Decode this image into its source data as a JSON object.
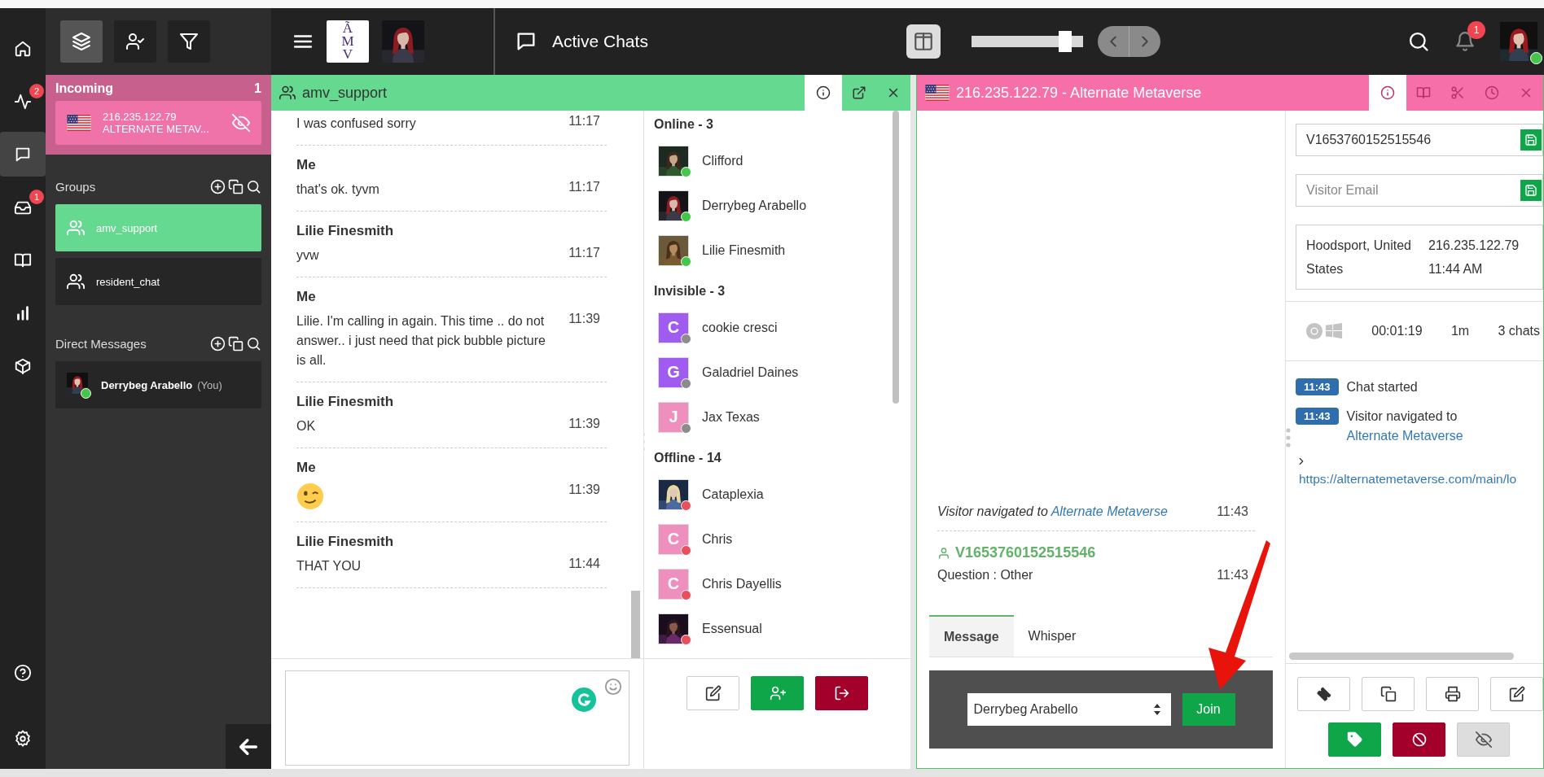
{
  "rail": {
    "items": [
      {
        "kind": "home",
        "selected": false
      },
      {
        "kind": "activity",
        "badge": "2",
        "selected": false
      },
      {
        "kind": "chat",
        "selected": true
      },
      {
        "kind": "inbox",
        "badge": "1",
        "selected": false
      },
      {
        "kind": "book",
        "selected": false
      },
      {
        "kind": "chart",
        "selected": false
      },
      {
        "kind": "cube",
        "selected": false
      }
    ],
    "bottom": [
      {
        "kind": "help",
        "selected": false
      },
      {
        "kind": "settings",
        "selected": false
      }
    ]
  },
  "sidebar": {
    "tools": [
      {
        "kind": "layers",
        "selected": true
      },
      {
        "kind": "user-check",
        "selected": false
      },
      {
        "kind": "filter",
        "selected": false
      }
    ],
    "incoming": {
      "title": "Incoming",
      "count": "1",
      "visitors": [
        {
          "ip": "216.235.122.79",
          "site": "ALTERNATE METAV..."
        }
      ]
    },
    "groups": {
      "title": "Groups",
      "items": [
        {
          "name": "amv_support",
          "selected": true
        },
        {
          "name": "resident_chat",
          "selected": false
        }
      ]
    },
    "direct_messages": {
      "title": "Direct Messages",
      "items": [
        {
          "name": "Derrybeg Arabello",
          "suffix": "(You)",
          "color": "#44c64a"
        }
      ]
    }
  },
  "topbar": {
    "logo": "ÃMV",
    "title": "Active Chats",
    "zoom": {
      "level": 0.9
    },
    "notifications": "1"
  },
  "group_chat": {
    "title": "amv_support",
    "tabs": [
      {
        "kind": "info",
        "selected": true
      },
      {
        "kind": "popout",
        "selected": false
      },
      {
        "kind": "close",
        "selected": false
      }
    ],
    "messages": [
      {
        "kind": "text",
        "text": "I was confused sorry",
        "time": "11:17"
      },
      {
        "kind": "text",
        "sender": "Me",
        "text": "that's ok. tyvm",
        "time": "11:17"
      },
      {
        "kind": "text",
        "sender": "Lilie Finesmith",
        "text": "yvw",
        "time": "11:17"
      },
      {
        "kind": "text",
        "sender": "Me",
        "text": "Lilie. I'm calling in again. This time .. do not answer.. i just need that pick bubble picture is all.",
        "time": "11:39"
      },
      {
        "kind": "text",
        "sender": "Lilie Finesmith",
        "text": "OK",
        "time": "11:39"
      },
      {
        "kind": "emoji",
        "sender": "Me",
        "time": "11:39"
      },
      {
        "kind": "text",
        "sender": "Lilie Finesmith",
        "text": "THAT YOU",
        "time": "11:44"
      }
    ],
    "members": [
      {
        "title": "Online - 3",
        "users": [
          {
            "name": "Clifford",
            "color": "#44c64a"
          },
          {
            "name": "Derrybeg Arabello",
            "color": "#44c64a"
          },
          {
            "name": "Lilie Finesmith",
            "color": "#44c64a"
          }
        ]
      },
      {
        "title": "Invisible - 3",
        "users": [
          {
            "name": "cookie cresci",
            "avatar": {
              "kind": "letter",
              "initial": "C",
              "color": "#a05cf0"
            },
            "color": "#8c8c8c"
          },
          {
            "name": "Galadriel Daines",
            "avatar": {
              "kind": "letter",
              "initial": "G",
              "color": "#a05cf0"
            },
            "color": "#8c8c8c"
          },
          {
            "name": "Jax Texas",
            "avatar": {
              "kind": "letter",
              "initial": "J",
              "color": "#ef8fbd"
            },
            "color": "#8c8c8c"
          }
        ]
      },
      {
        "title": "Offline - 14",
        "users": [
          {
            "name": "Cataplexia",
            "color": "#e8505b"
          },
          {
            "name": "Chris",
            "avatar": {
              "kind": "letter",
              "initial": "C",
              "color": "#ef8fbd"
            },
            "color": "#e8505b"
          },
          {
            "name": "Chris Dayellis",
            "avatar": {
              "kind": "letter",
              "initial": "C",
              "color": "#ef8fbd"
            },
            "color": "#e8505b"
          },
          {
            "name": "Essensual",
            "color": "#e8505b"
          }
        ]
      }
    ],
    "actions": [
      {
        "kind": "edit"
      },
      {
        "kind": "user-plus"
      },
      {
        "kind": "logout"
      }
    ]
  },
  "visitor_chat": {
    "title": "216.235.122.79 - Alternate Metaverse",
    "tabs": [
      {
        "kind": "info",
        "selected": true
      },
      {
        "kind": "book",
        "selected": false
      },
      {
        "kind": "scissors",
        "selected": false
      },
      {
        "kind": "clock",
        "selected": false
      },
      {
        "kind": "close",
        "selected": false
      }
    ],
    "events": [
      {
        "kind": "navigation",
        "text": "Visitor navigated to",
        "link": "Alternate Metaverse",
        "time": "11:43"
      },
      {
        "kind": "question",
        "visitor": "V1653760152515546",
        "text": "Question : Other",
        "time": "11:43"
      }
    ],
    "compose_tabs": [
      {
        "label": "Message",
        "selected": true
      },
      {
        "label": "Whisper",
        "selected": false
      }
    ],
    "agent": "Derrybeg Arabello",
    "join": "Join"
  },
  "visitor_info": {
    "visitor_id": "V1653760152515546",
    "email_placeholder": "Visitor Email",
    "location": "Hoodsport, United States",
    "ip": "216.235.122.79",
    "local_time": "11:44 AM",
    "duration": "00:01:19",
    "idle": "1m",
    "chats": "3 chats",
    "timeline": [
      {
        "time": "11:43",
        "text": "Chat started"
      },
      {
        "time": "11:43",
        "text": "Visitor navigated to",
        "link": "Alternate Metaverse"
      }
    ],
    "url": "https://alternatemetaverse.com/main/lo",
    "actions": [
      {
        "kind": "ticket"
      },
      {
        "kind": "copy"
      },
      {
        "kind": "print"
      },
      {
        "kind": "edit"
      }
    ],
    "actions2": [
      {
        "kind": "tag"
      },
      {
        "kind": "ban"
      },
      {
        "kind": "eye-off"
      }
    ]
  }
}
